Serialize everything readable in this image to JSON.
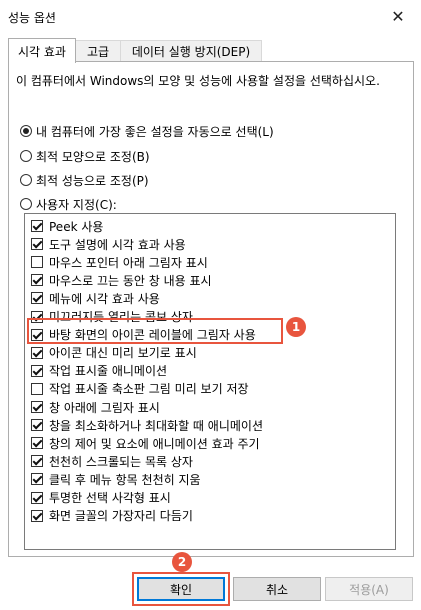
{
  "window": {
    "title": "성능 옵션"
  },
  "tabs": [
    {
      "label": "시각 효과"
    },
    {
      "label": "고급"
    },
    {
      "label": "데이터 실행 방지(DEP)"
    }
  ],
  "visual_effects": {
    "description": "이 컴퓨터에서 Windows의 모양 및 성능에 사용할 설정을 선택하십시오.",
    "options": [
      {
        "label": "내 컴퓨터에 가장 좋은 설정을 자동으로 선택(L)",
        "selected": true
      },
      {
        "label": "최적 모양으로 조정(B)",
        "selected": false
      },
      {
        "label": "최적 성능으로 조정(P)",
        "selected": false
      },
      {
        "label": "사용자 지정(C):",
        "selected": false
      }
    ],
    "effects": [
      {
        "label": "Peek 사용",
        "checked": true
      },
      {
        "label": "도구 설명에 시각 효과 사용",
        "checked": true
      },
      {
        "label": "마우스 포인터 아래 그림자 표시",
        "checked": false
      },
      {
        "label": "마우스로 끄는 동안 창 내용 표시",
        "checked": true
      },
      {
        "label": "메뉴에 시각 효과 사용",
        "checked": true
      },
      {
        "label": "미끄러지듯 열리는 콤보 상자",
        "checked": true
      },
      {
        "label": "바탕 화면의 아이콘 레이블에 그림자 사용",
        "checked": true
      },
      {
        "label": "아이콘 대신 미리 보기로 표시",
        "checked": true
      },
      {
        "label": "작업 표시줄 애니메이션",
        "checked": true
      },
      {
        "label": "작업 표시줄 축소판 그림 미리 보기 저장",
        "checked": false
      },
      {
        "label": "창 아래에 그림자 표시",
        "checked": true
      },
      {
        "label": "창을 최소화하거나 최대화할 때 애니메이션",
        "checked": true
      },
      {
        "label": "창의 제어 및 요소에 애니메이션 효과 주기",
        "checked": true
      },
      {
        "label": "천천히 스크롤되는 목록 상자",
        "checked": true
      },
      {
        "label": "클릭 후 메뉴 항목 천천히 지움",
        "checked": true
      },
      {
        "label": "투명한 선택 사각형 표시",
        "checked": true
      },
      {
        "label": "화면 글꼴의 가장자리 다듬기",
        "checked": true
      }
    ]
  },
  "annotations": {
    "badge1": "1",
    "badge2": "2",
    "color": "#e8553e"
  },
  "buttons": {
    "ok": "확인",
    "cancel": "취소",
    "apply": "적용(A)"
  }
}
